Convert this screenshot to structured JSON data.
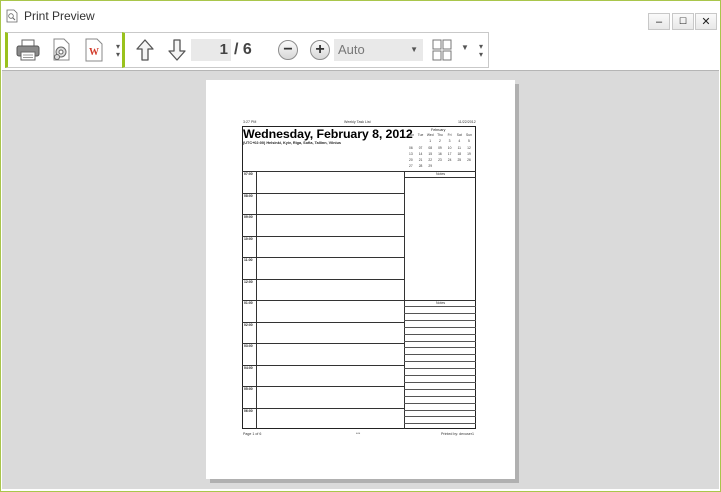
{
  "window": {
    "title": "Print Preview",
    "minimize": "–",
    "maximize": "☐",
    "close": "✕"
  },
  "toolbar": {
    "print_icon": "printer-icon",
    "settings_icon": "page-settings-gear-icon",
    "export_icon": "export-word-document-icon",
    "prev_page_icon": "arrow-up-icon",
    "next_page_icon": "arrow-down-icon",
    "current_page": "1",
    "page_separator": "/ 6",
    "zoom_out": "−",
    "zoom_in": "+",
    "zoom_value": "Auto",
    "page_layout_icon": "multi-page-layout-icon"
  },
  "page": {
    "header_left": "3:27 PM",
    "header_center": "Weekly Task List",
    "header_right": "11/22/2012",
    "day_heading": "Wednesday, February 8, 2012",
    "timezone": "(UTC+02:00) Helsinki, Kyiv, Riga, Sofia, Tallinn, Vilnius",
    "times": [
      "07:00",
      "08:00",
      "09:00",
      "10:00",
      "11:00",
      "12:00",
      "01:00",
      "02:00",
      "03:00",
      "04:00",
      "05:00",
      "06:00"
    ],
    "calendar": {
      "month": "February",
      "weekdays": [
        "Mon",
        "Tue",
        "Wed",
        "Thu",
        "Fri",
        "Sat",
        "Sun"
      ],
      "weeks": [
        [
          "",
          "",
          "1",
          "2",
          "3",
          "4",
          "5"
        ],
        [
          "06",
          "07",
          "08",
          "09",
          "10",
          "11",
          "12"
        ],
        [
          "13",
          "14",
          "15",
          "16",
          "17",
          "18",
          "19"
        ],
        [
          "20",
          "21",
          "22",
          "23",
          "24",
          "25",
          "26"
        ],
        [
          "27",
          "28",
          "29",
          "",
          "",
          "",
          ""
        ]
      ]
    },
    "notes_label_1": "Notes",
    "notes_label_2": "Notes",
    "footer_left": "Page 1 of 6",
    "footer_center": "***",
    "footer_right": "Printed by: devuser1"
  }
}
